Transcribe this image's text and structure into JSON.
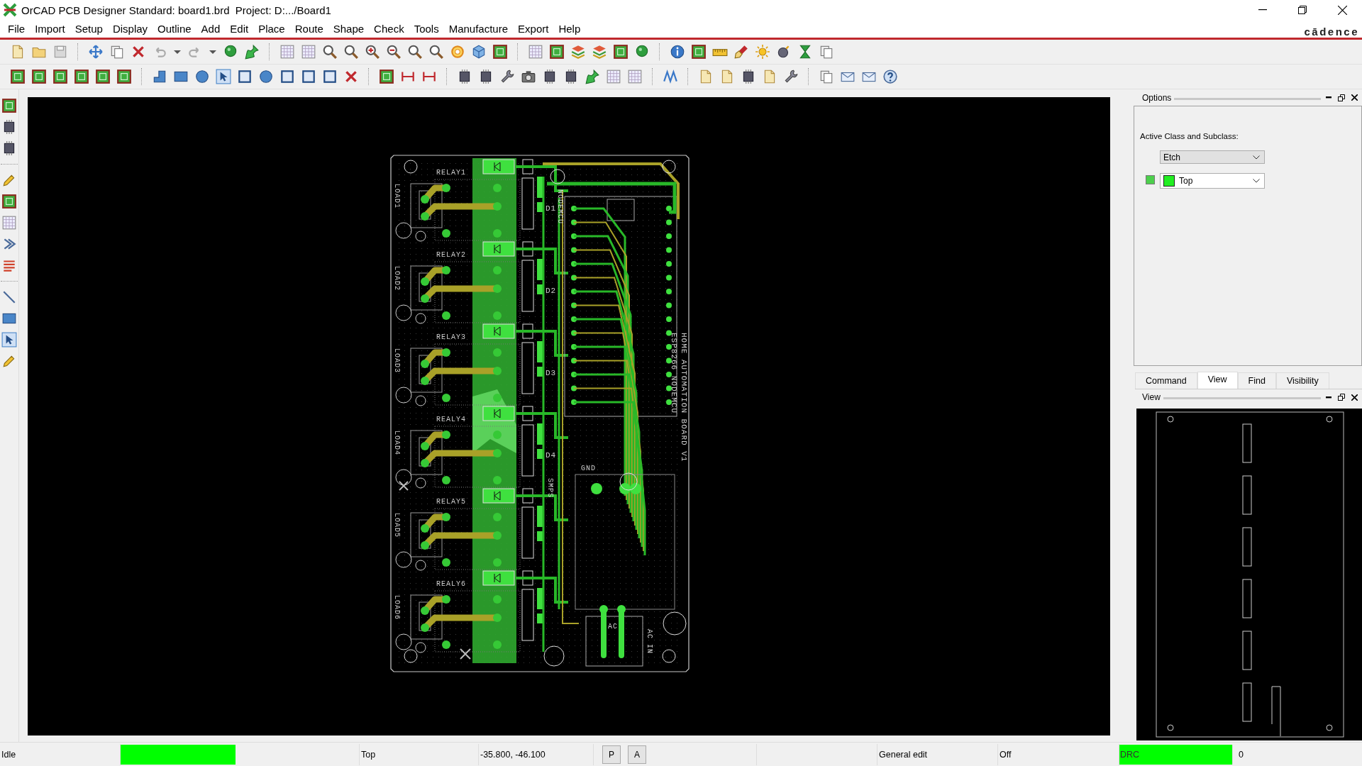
{
  "window": {
    "title": "OrCAD PCB Designer Standard: board1.brd  Project: D:.../Board1",
    "brand": "cādence"
  },
  "menu": [
    "File",
    "Import",
    "Setup",
    "Display",
    "Outline",
    "Add",
    "Edit",
    "Place",
    "Route",
    "Shape",
    "Check",
    "Tools",
    "Manufacture",
    "Export",
    "Help"
  ],
  "board": {
    "relays": [
      "RELAY1",
      "RELAY2",
      "RELAY3",
      "REALY4",
      "RELAY5",
      "REALY6"
    ],
    "loads": [
      "LOAD1",
      "LOAD2",
      "LOAD3",
      "LOAD4",
      "LOAD5",
      "LOAD6"
    ],
    "diodes": [
      "D1",
      "D2",
      "D3",
      "D4"
    ],
    "notes": [
      {
        "kind": "title",
        "text": "HOME AUTOMATION BOARD V1"
      },
      {
        "kind": "module",
        "text": "ESP8266 NODEMCU"
      },
      {
        "kind": "nodemcu",
        "text": "NODEMCU"
      },
      {
        "kind": "smps",
        "text": "SMPS"
      },
      {
        "kind": "gnd",
        "text": "GND"
      },
      {
        "kind": "ac",
        "text": "AC"
      },
      {
        "kind": "ac_in",
        "text": "AC IN"
      }
    ]
  },
  "options": {
    "title": "Options",
    "class_label": "Active Class and Subclass:",
    "class_value": "Etch",
    "subclass_value": "Top"
  },
  "tabs": [
    {
      "label": "Command",
      "selected": false
    },
    {
      "label": "View",
      "selected": true
    },
    {
      "label": "Find",
      "selected": false
    },
    {
      "label": "Visibility",
      "selected": false
    }
  ],
  "view_panel": {
    "title": "View"
  },
  "status_bar": {
    "state": "Idle",
    "layer": "Top",
    "coordinates": "-35.800, -46.100",
    "p_button": "P",
    "a_button": "A",
    "mode": "General edit",
    "setting": "Off",
    "drc": "DRC",
    "drc_count": "0"
  }
}
